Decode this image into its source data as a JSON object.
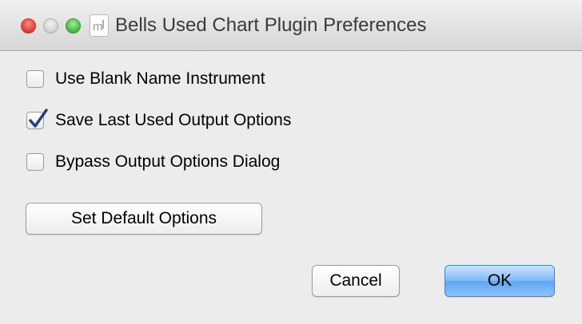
{
  "window": {
    "title": "Bells Used Chart Plugin Preferences",
    "app_icon": "musescore-icon"
  },
  "options": [
    {
      "label": "Use Blank Name Instrument",
      "checked": false
    },
    {
      "label": "Save Last Used Output Options",
      "checked": true
    },
    {
      "label": "Bypass Output Options Dialog",
      "checked": false
    }
  ],
  "buttons": {
    "set_default": "Set Default Options",
    "cancel": "Cancel",
    "ok": "OK"
  },
  "colors": {
    "close": "#e0443e",
    "zoom": "#4fbf4a",
    "default_button": "#5fa3f0"
  }
}
